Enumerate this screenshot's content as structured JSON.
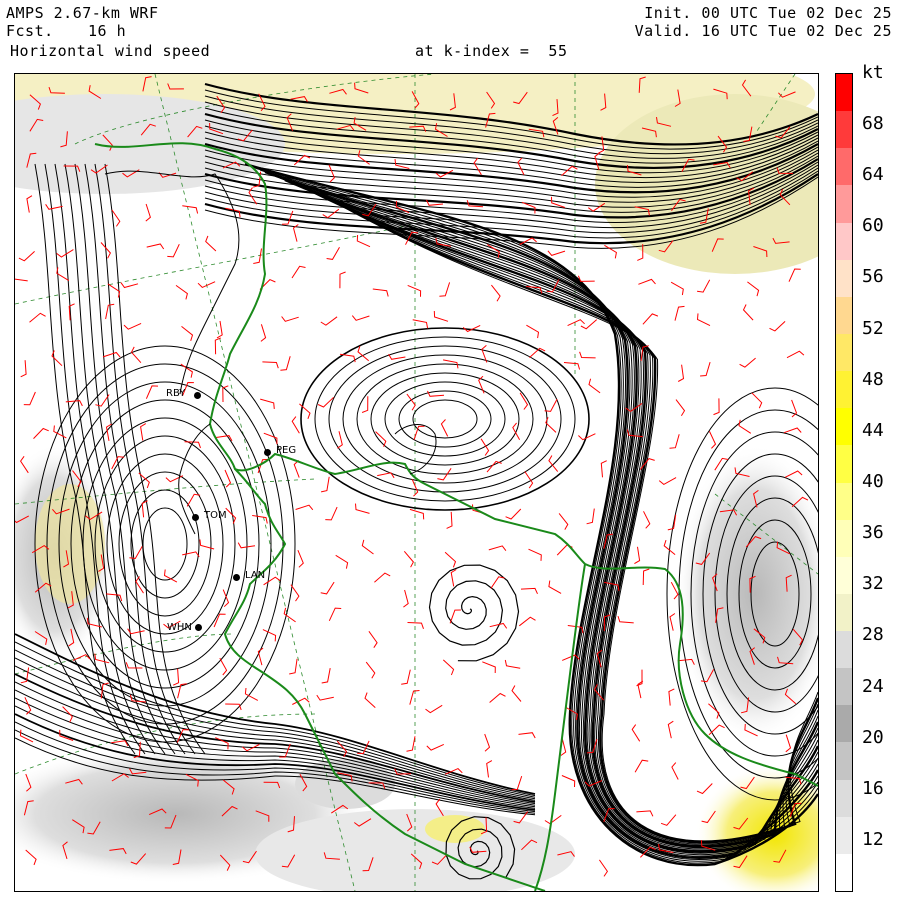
{
  "header": {
    "model": "AMPS 2.67-km WRF",
    "fcst_label": "Fcst.",
    "fcst_value": "16 h",
    "field": "Horizontal wind speed",
    "level": "at k-index =  55",
    "init": "Init. 00 UTC Tue 02 Dec 25",
    "valid": "Valid. 16 UTC Tue 02 Dec 25"
  },
  "colorbar": {
    "unit": "kt",
    "ticks": [
      "68",
      "64",
      "60",
      "56",
      "52",
      "48",
      "44",
      "40",
      "36",
      "32",
      "28",
      "24",
      "20",
      "16",
      "12"
    ],
    "colors": [
      "#ff0000",
      "#ff3a3a",
      "#ff6a6a",
      "#ff9a9a",
      "#ffc8c8",
      "#ffe2c8",
      "#ffd890",
      "#ffe866",
      "#fff233",
      "#ffff00",
      "#ffff44",
      "#ffff88",
      "#ffffb8",
      "#ffffd8",
      "#f2f2c8",
      "#dcdcdc",
      "#c4c4c4",
      "#aaaaaa",
      "#c4c4c4",
      "#dcdcdc",
      "#ebebeb",
      "#ffffff"
    ]
  },
  "stations": [
    {
      "id": "RBY"
    },
    {
      "id": "PEG"
    },
    {
      "id": "TOM"
    },
    {
      "id": "LAN"
    },
    {
      "id": "WHN"
    }
  ],
  "styles": {
    "coast_color": "#1a8a1a",
    "barb_color": "#ff0000",
    "streamline_color": "#000000",
    "grid_color": "#2e8b2e"
  }
}
